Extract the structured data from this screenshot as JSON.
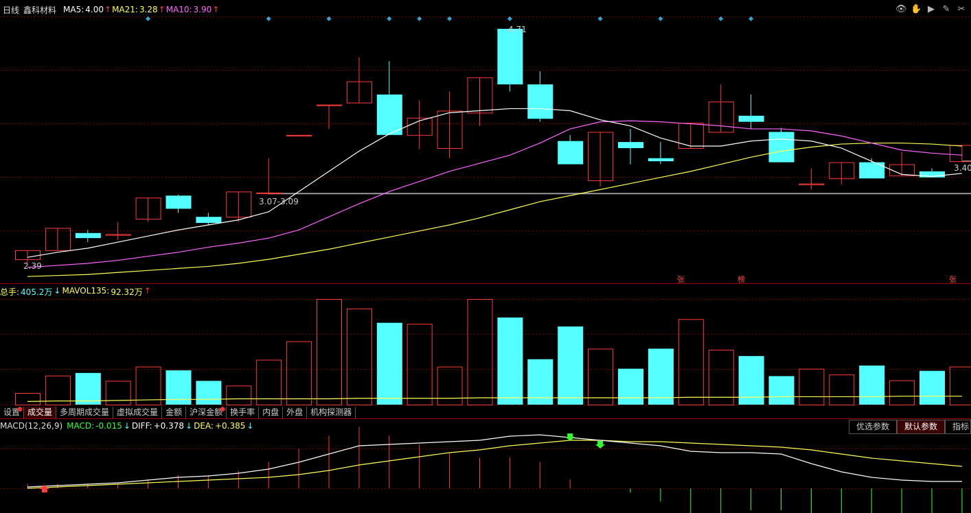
{
  "header": {
    "period": "日线",
    "stock_name": "鑫科材料",
    "ma5_label": "MA5:",
    "ma5_value": "4.00",
    "ma21_label": "MA21:",
    "ma21_value": "3.28",
    "ma10_label": "MA10:",
    "ma10_value": "3.90"
  },
  "price_panel": {
    "high_label": "4.71",
    "low_label": "2.39",
    "range_label": "3.07-3.09",
    "last_label": "3.40",
    "markers": [
      "张",
      "榜",
      "张"
    ]
  },
  "volume_panel": {
    "total_label": "总手:",
    "total_value": "405.2万",
    "mavol_label": "MAVOL135:",
    "mavol_value": "92.32万"
  },
  "tabs": [
    {
      "label": "设置",
      "dot": true
    },
    {
      "label": "成交量",
      "active": true
    },
    {
      "label": "多周期成交量"
    },
    {
      "label": "虚拟成交量"
    },
    {
      "label": "金额"
    },
    {
      "label": "沪深金额",
      "dot": true
    },
    {
      "label": "换手率"
    },
    {
      "label": "内盘"
    },
    {
      "label": "外盘"
    },
    {
      "label": "机构探测器"
    }
  ],
  "macd_panel": {
    "title": "MACD(12,26,9)",
    "macd_label": "MACD:",
    "macd_value": "-0.015",
    "diff_label": "DIFF:",
    "diff_value": "+0.378",
    "dea_label": "DEA:",
    "dea_value": "+0.385",
    "buttons": [
      "优选参数",
      "默认参数",
      "指标"
    ]
  },
  "colors": {
    "up": "#ff3b3b",
    "down": "#54ffff",
    "ma5": "#ffffff",
    "ma10": "#ff66ff",
    "ma21": "#ffff55",
    "grid": "#7a0000"
  },
  "chart_data": {
    "type": "candlestick",
    "candles": [
      {
        "o": 2.43,
        "c": 2.52,
        "h": 2.52,
        "l": 2.39
      },
      {
        "o": 2.52,
        "c": 2.74,
        "h": 2.74,
        "l": 2.52
      },
      {
        "o": 2.69,
        "c": 2.64,
        "h": 2.72,
        "l": 2.6
      },
      {
        "o": 2.67,
        "c": 2.68,
        "h": 2.8,
        "l": 2.62
      },
      {
        "o": 2.83,
        "c": 3.04,
        "h": 3.04,
        "l": 2.8
      },
      {
        "o": 3.06,
        "c": 2.93,
        "h": 3.07,
        "l": 2.89
      },
      {
        "o": 2.85,
        "c": 2.79,
        "h": 2.89,
        "l": 2.77
      },
      {
        "o": 2.85,
        "c": 3.1,
        "h": 3.1,
        "l": 2.8
      },
      {
        "o": 3.09,
        "c": 3.09,
        "h": 3.43,
        "l": 3.07
      },
      {
        "o": 3.66,
        "c": 3.66,
        "h": 3.66,
        "l": 3.66
      },
      {
        "o": 3.96,
        "c": 3.96,
        "h": 3.96,
        "l": 3.72
      },
      {
        "o": 3.98,
        "c": 4.19,
        "h": 4.43,
        "l": 3.98
      },
      {
        "o": 4.06,
        "c": 3.66,
        "h": 4.39,
        "l": 3.66
      },
      {
        "o": 3.66,
        "c": 3.83,
        "h": 4.0,
        "l": 3.52
      },
      {
        "o": 3.53,
        "c": 3.9,
        "h": 4.09,
        "l": 3.43
      },
      {
        "o": 3.88,
        "c": 4.23,
        "h": 4.23,
        "l": 3.75
      },
      {
        "o": 4.71,
        "c": 4.16,
        "h": 4.71,
        "l": 4.09
      },
      {
        "o": 4.16,
        "c": 3.82,
        "h": 4.29,
        "l": 3.79
      },
      {
        "o": 3.6,
        "c": 3.37,
        "h": 3.66,
        "l": 3.37
      },
      {
        "o": 3.21,
        "c": 3.69,
        "h": 3.69,
        "l": 3.15
      },
      {
        "o": 3.59,
        "c": 3.53,
        "h": 3.72,
        "l": 3.37
      },
      {
        "o": 3.43,
        "c": 3.4,
        "h": 3.59,
        "l": 3.37
      },
      {
        "o": 3.53,
        "c": 3.78,
        "h": 3.78,
        "l": 3.53
      },
      {
        "o": 3.69,
        "c": 3.99,
        "h": 4.16,
        "l": 3.69
      },
      {
        "o": 3.85,
        "c": 3.79,
        "h": 4.06,
        "l": 3.72
      },
      {
        "o": 3.69,
        "c": 3.39,
        "h": 3.73,
        "l": 3.39
      },
      {
        "o": 3.17,
        "c": 3.18,
        "h": 3.33,
        "l": 3.12
      },
      {
        "o": 3.23,
        "c": 3.39,
        "h": 3.39,
        "l": 3.17
      },
      {
        "o": 3.39,
        "c": 3.23,
        "h": 3.43,
        "l": 3.23
      },
      {
        "o": 3.26,
        "c": 3.37,
        "h": 3.49,
        "l": 3.26
      },
      {
        "o": 3.3,
        "c": 3.24,
        "h": 3.33,
        "l": 3.24
      },
      {
        "o": 3.4,
        "c": 3.56,
        "h": 3.56,
        "l": 3.4
      }
    ],
    "ma5": [
      2.45,
      2.5,
      2.54,
      2.6,
      2.66,
      2.72,
      2.77,
      2.82,
      2.9,
      3.1,
      3.3,
      3.5,
      3.67,
      3.8,
      3.88,
      3.9,
      3.92,
      3.92,
      3.9,
      3.81,
      3.75,
      3.63,
      3.55,
      3.55,
      3.6,
      3.62,
      3.6,
      3.53,
      3.4,
      3.27,
      3.25,
      3.28
    ],
    "ma10": [
      2.35,
      2.37,
      2.39,
      2.42,
      2.46,
      2.5,
      2.55,
      2.59,
      2.64,
      2.72,
      2.85,
      2.98,
      3.1,
      3.2,
      3.3,
      3.38,
      3.46,
      3.58,
      3.72,
      3.79,
      3.8,
      3.79,
      3.77,
      3.75,
      3.72,
      3.72,
      3.7,
      3.65,
      3.58,
      3.51,
      3.48,
      3.46
    ],
    "ma21": [
      2.26,
      2.27,
      2.28,
      2.3,
      2.32,
      2.34,
      2.36,
      2.39,
      2.43,
      2.48,
      2.53,
      2.59,
      2.65,
      2.71,
      2.77,
      2.84,
      2.92,
      3.0,
      3.06,
      3.12,
      3.18,
      3.24,
      3.3,
      3.37,
      3.44,
      3.5,
      3.54,
      3.57,
      3.58,
      3.58,
      3.57,
      3.55
    ],
    "volume": [
      22,
      55,
      60,
      45,
      72,
      65,
      45,
      36,
      85,
      120,
      200,
      182,
      155,
      153,
      72,
      200,
      165,
      86,
      148,
      106,
      68,
      106,
      162,
      104,
      92,
      54,
      68,
      57,
      74,
      46,
      64,
      72
    ],
    "mavol": [
      6,
      7,
      7,
      8,
      9,
      10,
      10,
      11,
      11,
      11,
      11,
      12,
      12,
      12,
      12,
      13,
      13,
      13,
      13,
      13,
      13,
      13,
      14,
      14,
      14,
      15,
      15,
      15,
      15,
      16,
      16,
      16
    ],
    "diff": [
      0.01,
      0.02,
      0.03,
      0.04,
      0.06,
      0.08,
      0.09,
      0.11,
      0.14,
      0.19,
      0.25,
      0.31,
      0.32,
      0.33,
      0.34,
      0.35,
      0.38,
      0.39,
      0.37,
      0.35,
      0.33,
      0.31,
      0.27,
      0.26,
      0.26,
      0.25,
      0.18,
      0.12,
      0.08,
      0.06,
      0.05,
      0.05
    ],
    "dea": [
      0.0,
      0.01,
      0.02,
      0.03,
      0.04,
      0.05,
      0.06,
      0.07,
      0.08,
      0.1,
      0.13,
      0.17,
      0.2,
      0.23,
      0.26,
      0.28,
      0.31,
      0.33,
      0.35,
      0.35,
      0.34,
      0.34,
      0.33,
      0.32,
      0.31,
      0.3,
      0.28,
      0.25,
      0.22,
      0.2,
      0.18,
      0.16
    ],
    "ylim_price": [
      2.2,
      4.85
    ]
  }
}
